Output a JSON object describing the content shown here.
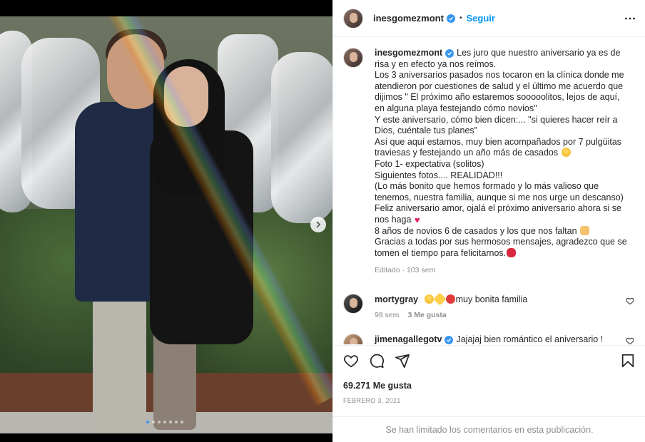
{
  "post": {
    "username": "inesgomezmont",
    "follow_label": "Seguir",
    "separator": "•"
  },
  "caption": {
    "username": "inesgomezmont",
    "lines": [
      "Les juro que nuestro aniversario ya es de risa y en efecto ya nos reímos.",
      "Los 3 aniversarios pasados nos tocaron en la clínica donde me atendieron por cuestiones de salud y el último me acuerdo que dijimos \" El próximo año estaremos sooooolitos, lejos de aquí, en alguna playa festejando cómo novios\"",
      "Y este aniversario, cómo bien dicen:... \"si quieres hacer reír a Dios, cuéntale tus planes\"",
      "Así que aquí estamos, muy bien acompañados por 7 pulgüitas traviesas y festejando un año más de casados",
      "Foto 1- expectativa (solitos)",
      "Siguientes fotos.... REALIDAD!!!",
      "(Lo más bonito que hemos formado y lo más valioso que tenemos, nuestra familia, aunque si me nos urge un descanso)",
      "Feliz aniversario amor, ojalá el próximo aniversario ahora si se nos haga",
      "8 años de novios 6 de casados y los que nos faltan",
      "Gracias a todas por sus hermosos mensajes, agradezco que se tomen el tiempo para felicitarnos."
    ],
    "meta": "Editado · 103 sem"
  },
  "comments": [
    {
      "username": "mortygray",
      "text": "muy bonita familia",
      "time": "98 sem",
      "likes": "3 Me gusta"
    },
    {
      "username": "jimenagallegotv",
      "text": "Jajajaj bien romántico el aniversario !"
    }
  ],
  "actions": {
    "likes": "69.271 Me gusta",
    "date": "FEBRERO 3, 2021"
  },
  "footer": {
    "limited_text": "Se han limitado los comentarios en esta publicación."
  },
  "icons": [
    "verified-icon",
    "more-icon",
    "heart-icon",
    "comment-icon",
    "share-icon",
    "bookmark-icon",
    "next-icon"
  ],
  "colors": {
    "accent": "#0095f6",
    "verified": "#3897f0",
    "muted": "#8e8e8e",
    "text": "#262626"
  },
  "carousel": {
    "slides": 7,
    "active_index": 0
  }
}
